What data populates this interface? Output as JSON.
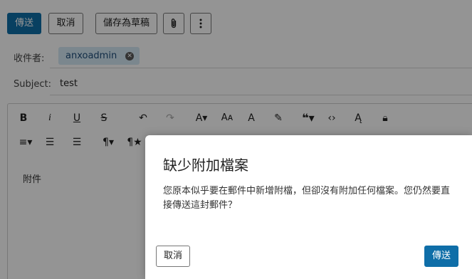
{
  "toolbar": {
    "send_label": "傳送",
    "cancel_label": "取消",
    "save_draft_label": "儲存為草稿",
    "attach_icon": "paperclip-icon",
    "more_icon": "more-vertical-icon"
  },
  "recipients": {
    "label": "收件者:",
    "chips": [
      {
        "name": "anxoadmin"
      }
    ]
  },
  "subject": {
    "label": "Subject:",
    "value": "test"
  },
  "editor": {
    "toolbar_row1": [
      "bold-icon",
      "italic-icon",
      "underline-icon",
      "strikethrough-icon",
      "undo-icon",
      "redo-icon",
      "font-size-icon",
      "font-family-icon",
      "text-color-icon",
      "highlight-icon",
      "quote-icon",
      "code-icon",
      "clear-format-icon",
      "lock-icon"
    ],
    "toolbar_row2": [
      "align-icon",
      "ordered-list-icon",
      "unordered-list-icon",
      "paragraph-icon",
      "paragraph-style-icon"
    ],
    "body_text": "附件"
  },
  "dialog": {
    "title": "缺少附加檔案",
    "message": "您原本似乎要在郵件中新增附檔，但卻沒有附加任何檔案。您仍然要直接傳送這封郵件？",
    "cancel_label": "取消",
    "send_label": "傳送"
  },
  "colors": {
    "primary": "#0f6ea8",
    "chip_bg": "#d4e8f5",
    "overlay": "rgba(0,0,0,0.42)"
  }
}
